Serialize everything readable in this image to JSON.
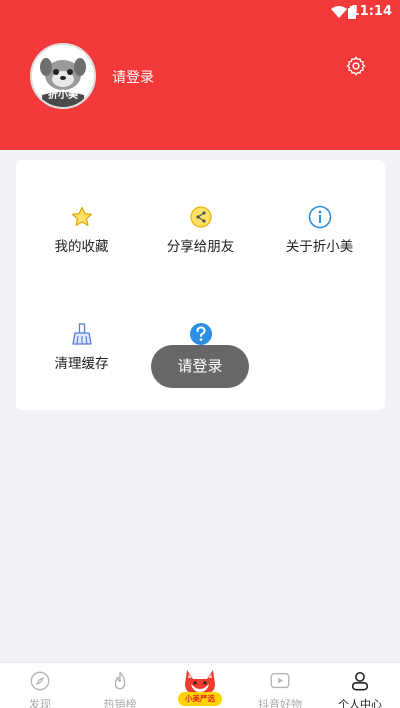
{
  "status_bar": {
    "time": "11:14"
  },
  "profile": {
    "avatar_brand": "折小美",
    "login_prompt": "请登录"
  },
  "menu": {
    "items": [
      {
        "label": "我的收藏",
        "icon": "star-icon"
      },
      {
        "label": "分享给朋友",
        "icon": "share-icon"
      },
      {
        "label": "关于折小美",
        "icon": "info-icon"
      },
      {
        "label": "清理缓存",
        "icon": "broom-icon"
      },
      {
        "label": "",
        "icon": "help-icon"
      }
    ]
  },
  "toast": {
    "text": "请登录"
  },
  "tabbar": {
    "tabs": [
      {
        "label": "发现",
        "icon": "compass-icon"
      },
      {
        "label": "热销榜",
        "icon": "flame-icon"
      },
      {
        "label": "小美严选",
        "icon": "fox-icon"
      },
      {
        "label": "抖音好物",
        "icon": "video-icon"
      },
      {
        "label": "个人中心",
        "icon": "person-icon"
      }
    ],
    "active": "个人中心"
  },
  "colors": {
    "brand_red": "#f4393b",
    "accent_yellow": "#ffd400",
    "info_blue": "#2b8fe6"
  }
}
